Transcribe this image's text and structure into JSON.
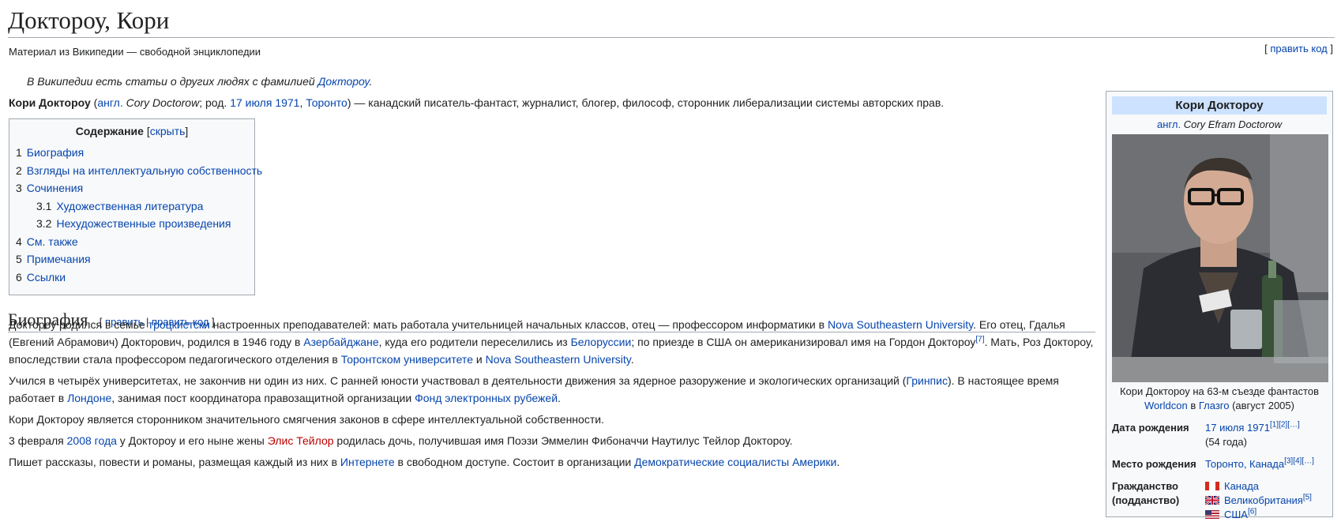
{
  "title": "Доктороу, Кори",
  "tagline": "Материал из Википедии — свободной энциклопедии",
  "edit_source": "править код",
  "hatnote": {
    "text": "В Википедии есть статьи о других людях с фамилией ",
    "link": "Доктороу",
    "end": "."
  },
  "lead": {
    "name": "Кори Доктороу",
    "lang": "англ.",
    "en_name": "Cory Doctorow",
    "born": "; род. ",
    "date": "17 июля 1971",
    "city": "Торонто",
    "rest": ") — канадский писатель-фантаст, журналист, блогер, философ, сторонник либерализации системы авторских прав."
  },
  "toc": {
    "title": "Содержание",
    "toggle": "скрыть",
    "items": [
      {
        "num": "1",
        "label": "Биография",
        "sub": false
      },
      {
        "num": "2",
        "label": "Взгляды на интеллектуальную собственность",
        "sub": false
      },
      {
        "num": "3",
        "label": "Сочинения",
        "sub": false
      },
      {
        "num": "3.1",
        "label": "Художественная литература",
        "sub": true
      },
      {
        "num": "3.2",
        "label": "Нехудожественные произведения",
        "sub": true
      },
      {
        "num": "4",
        "label": "См. также",
        "sub": false
      },
      {
        "num": "5",
        "label": "Примечания",
        "sub": false
      },
      {
        "num": "6",
        "label": "Ссылки",
        "sub": false
      }
    ]
  },
  "section": {
    "heading": "Биография",
    "edit": "править",
    "edit_code": "править код"
  },
  "paragraphs": {
    "p1": {
      "a": "Доктороу родился в семье ",
      "l1": "троцкистски",
      "b": " настроенных преподавателей: мать работала учительницей начальных классов, отец — профессором информатики в ",
      "l2": "Nova Southeastern University",
      "c": ". Его отец, Гдалья (Евгений Абрамович) Докторович, родился в 1946 году в ",
      "l3": "Азербайджане",
      "d": ", куда его родители переселились из ",
      "l4": "Белоруссии",
      "e": "; по приезде в США он американизировал имя на Гордон Доктороу",
      "ref": "[7]",
      "f": ". Мать, Роз Доктороу, впоследствии стала профессором педагогического отделения в ",
      "l5": "Торонтском университете",
      "g": " и ",
      "l6": "Nova Southeastern University",
      "h": "."
    },
    "p2": {
      "a": "Учился в четырёх университетах, не закончив ни один из них. С ранней юности участвовал в деятельности движения за ядерное разоружение и экологических организаций (",
      "l1": "Гринпис",
      "b": "). В настоящее время работает в ",
      "l2": "Лондоне",
      "c": ", занимая пост координатора правозащитной организации ",
      "l3": "Фонд электронных рубежей",
      "d": "."
    },
    "p3": "Кори Доктороу является сторонником значительного смягчения законов в сфере интеллектуальной собственности.",
    "p4": {
      "a": "3 февраля ",
      "l1": "2008 года",
      "b": " у Доктороу и его ныне жены ",
      "red": "Элис Тейлор",
      "c": " родилась дочь, получившая имя Поэзи Эммелин Фибоначчи Наутилус Тейлор Доктороу."
    },
    "p5": {
      "a": "Пишет рассказы, повести и романы, размещая каждый из них в ",
      "l1": "Интернете",
      "b": " в свободном доступе. Состоит в организации ",
      "l2": "Демократические социалисты Америки",
      "c": "."
    }
  },
  "infobox": {
    "title": "Кори Доктороу",
    "lang": "англ.",
    "en_name": "Cory Efram Doctorow",
    "caption": {
      "a": "Кори Доктороу на 63-м съезде фантастов",
      "l1": "Worldcon",
      "b": " в ",
      "l2": "Глазго",
      "c": " (август 2005)"
    },
    "birth_date": {
      "label": "Дата рождения",
      "date": "17 июля 1971",
      "refs": "[1][2][…]",
      "age": "(54 года)"
    },
    "birth_place": {
      "label": "Место рождения",
      "value": "Торонто, Канада",
      "refs": "[3][4][…]"
    },
    "citizenship": {
      "label": "Гражданство (подданство)",
      "items": [
        {
          "name": "Канада",
          "ref": ""
        },
        {
          "name": "Великобритания",
          "ref": "[5]"
        },
        {
          "name": "США",
          "ref": "[6]"
        }
      ]
    }
  }
}
